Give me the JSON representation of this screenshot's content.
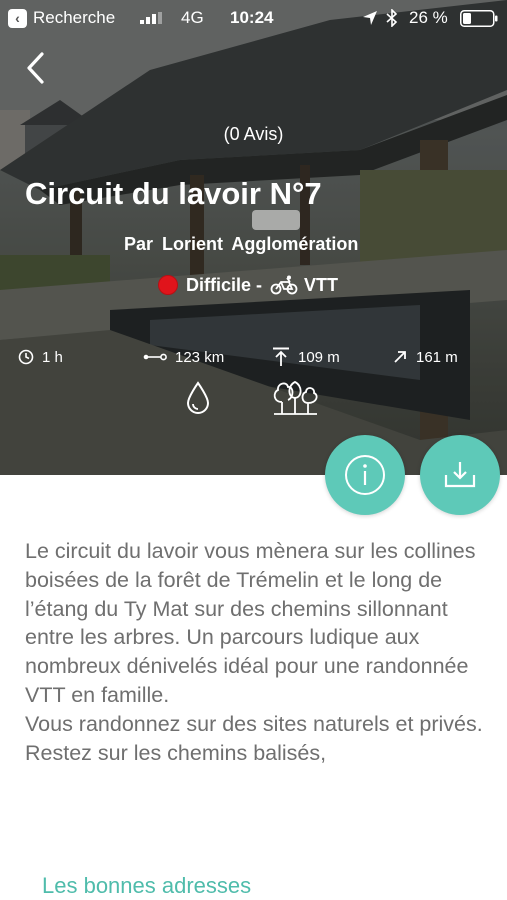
{
  "status_bar": {
    "back_app": "Recherche",
    "network": "4G",
    "time": "10:24",
    "battery": "26 %"
  },
  "hero": {
    "reviews": "(0 Avis)",
    "title": "Circuit du lavoir N°7",
    "author": "Par Lorient Agglomération",
    "difficulty": "Difficile -",
    "difficulty_color": "#e0141b",
    "activity": "VTT",
    "features": [
      "water-drop-icon",
      "forest-icon"
    ]
  },
  "stats": {
    "duration": "1 h",
    "distance": "123 km",
    "max_altitude": "109 m",
    "elevation_gain": "161 m"
  },
  "actions": {
    "accent": "#5ec9b8"
  },
  "description": {
    "paragraph_1": "Le circuit du lavoir vous mènera sur les collines boisées de la forêt de Trémelin et le long de l’étang du Ty Mat sur des chemins sillonnant entre les arbres. Un parcours ludique aux nombreux dénivelés idéal pour une randonnée VTT en famille.",
    "paragraph_2": "Vous randonnez sur des sites naturels et privés. Restez sur les chemins balisés,"
  },
  "sections": {
    "good_addresses": "Les bonnes adresses"
  }
}
